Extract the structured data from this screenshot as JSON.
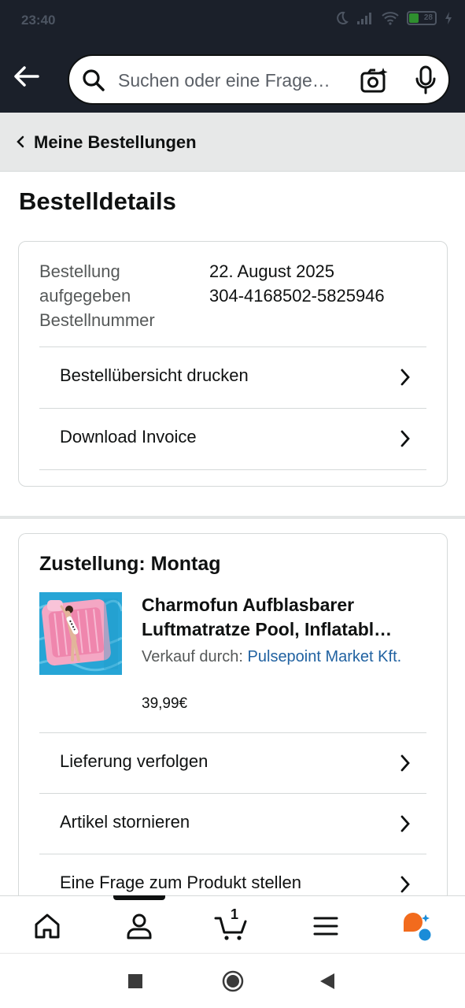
{
  "status_bar": {
    "time": "23:40",
    "battery": "28"
  },
  "search": {
    "placeholder": "Suchen oder eine Frage…"
  },
  "breadcrumb": {
    "label": "Meine Bestellungen"
  },
  "page": {
    "title": "Bestelldetails"
  },
  "order": {
    "placed_label_line1": "Bestellung",
    "placed_label_line2": "aufgegeben",
    "number_label": "Bestellnummer",
    "date": "22. August 2025",
    "number": "304-4168502-5825946"
  },
  "order_actions": [
    {
      "label": "Bestellübersicht drucken"
    },
    {
      "label": "Download Invoice"
    }
  ],
  "delivery": {
    "title": "Zustellung: Montag",
    "product": {
      "title_line1": "Charmofun Aufblasbarer",
      "title_line2": "Luftmatratze Pool, Inflatabl…",
      "seller_prefix": "Verkauf durch:",
      "seller_name": "Pulsepoint Market Kft.",
      "price": "39,99€"
    },
    "actions": [
      {
        "label": "Lieferung verfolgen"
      },
      {
        "label": "Artikel stornieren"
      },
      {
        "label": "Eine Frage zum Produkt stellen"
      }
    ]
  },
  "bottom_nav": {
    "items": [
      "home-icon",
      "account-icon",
      "cart-icon",
      "menu-icon",
      "rufus-icon"
    ],
    "cart_count": "1",
    "active": "account-icon"
  },
  "colors": {
    "header_bg": "#1b202a",
    "link": "#2162a1",
    "breadcrumb_bg": "#e7e8e8",
    "rufus_orange": "#f26b1d",
    "rufus_blue": "#1a8cd8"
  }
}
